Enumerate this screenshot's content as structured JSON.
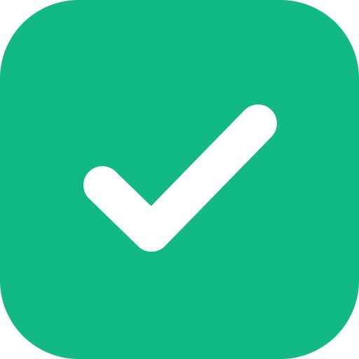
{
  "icon": {
    "name": "checkmark-icon",
    "state": "checked",
    "background_color": "#12B886",
    "check_color": "#FFFFFF"
  }
}
